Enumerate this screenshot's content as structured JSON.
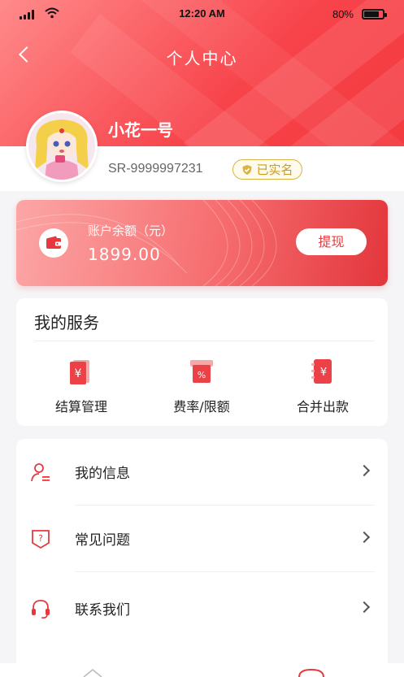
{
  "status_bar": {
    "time": "12:20 AM",
    "battery_pct": "80%"
  },
  "header": {
    "title": "个人中心",
    "back_icon": "chevron-left-icon"
  },
  "profile": {
    "username": "小花一号",
    "user_id": "SR-9999997231",
    "verified_label": "已实名"
  },
  "balance": {
    "label": "账户余额（元）",
    "value": "1899.00",
    "withdraw_label": "提现",
    "accent": "#e8383d"
  },
  "services": {
    "title": "我的服务",
    "items": [
      {
        "label": "结算管理",
        "icon": "settlement-icon"
      },
      {
        "label": "费率/限额",
        "icon": "rate-limit-icon"
      },
      {
        "label": "合并出款",
        "icon": "merge-payout-icon"
      }
    ]
  },
  "menu": {
    "items": [
      {
        "label": "我的信息",
        "icon": "user-info-icon"
      },
      {
        "label": "常见问题",
        "icon": "faq-icon"
      },
      {
        "label": "联系我们",
        "icon": "headset-icon"
      }
    ]
  },
  "colors": {
    "primary": "#f5454a",
    "gold": "#d9b445"
  }
}
